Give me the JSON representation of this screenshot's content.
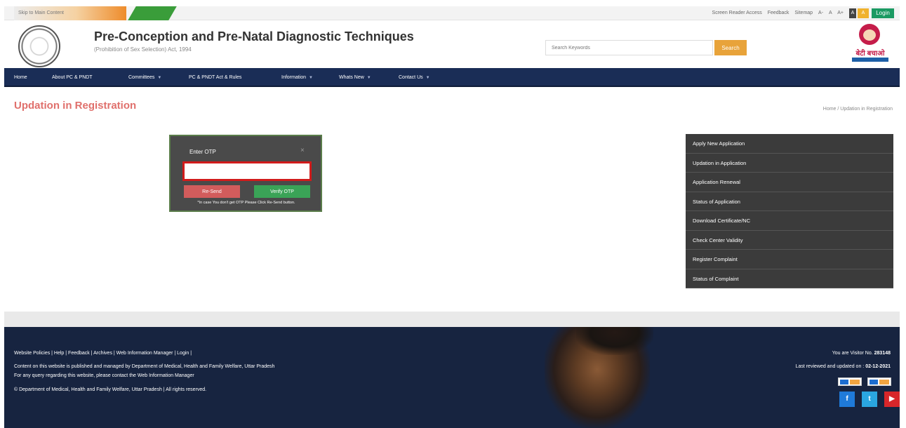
{
  "topbar": {
    "skip_label": "Skip to Main Content",
    "links": [
      "Screen Reader Access",
      "Feedback",
      "Sitemap",
      "A-",
      "A",
      "A+"
    ],
    "contrast_a": "A",
    "contrast_c": "A",
    "login_label": "Login"
  },
  "header": {
    "title": "Pre-Conception and Pre-Natal Diagnostic Techniques",
    "subtitle": "(Prohibition of Sex Selection) Act, 1994",
    "search_placeholder": "Search Keywords",
    "search_button": "Search",
    "logo_text": "बेटी बचाओ"
  },
  "nav": {
    "items": [
      {
        "label": "Home",
        "dropdown": false
      },
      {
        "label": "About PC & PNDT",
        "dropdown": false
      },
      {
        "label": "Committees",
        "dropdown": true
      },
      {
        "label": "PC & PNDT Act & Rules",
        "dropdown": false
      },
      {
        "label": "Information",
        "dropdown": true
      },
      {
        "label": "Whats New",
        "dropdown": true
      },
      {
        "label": "Contact Us",
        "dropdown": true
      }
    ]
  },
  "page": {
    "title": "Updation in Registration",
    "breadcrumb": "Home / Updation in Registration"
  },
  "otp": {
    "label": "Enter OTP",
    "close": "×",
    "value": "",
    "resend_label": "Re-Send",
    "verify_label": "Verify OTP",
    "note": "*In case You don't get OTP Please Click Re-Send button."
  },
  "sidebar": {
    "items": [
      {
        "label": "Apply New Application"
      },
      {
        "label": "Updation in Application"
      },
      {
        "label": "Application Renewal"
      },
      {
        "label": "Status of Application"
      },
      {
        "label": "Download Certificate/NC"
      },
      {
        "label": "Check Center Validity"
      },
      {
        "label": "Register Complaint"
      },
      {
        "label": "Status of Complaint"
      }
    ]
  },
  "footer": {
    "links": "Website Policies | Help | Feedback | Archives | Web Information Manager | Login |",
    "line1": "Content on this website is published and managed by Department of Medical, Health and Family Welfare, Uttar Pradesh",
    "line2": "For any query regarding this website, please contact the Web Information Manager",
    "line3": "© Department of Medical, Health and Family Welfare, Uttar Pradesh | All rights reserved.",
    "visitor_label": "You are Visitor No.",
    "visitor_count": "283148",
    "updated_label": "Last reviewed and updated on :",
    "updated_date": "02-12-2021",
    "social": {
      "facebook": "f",
      "twitter": "t",
      "youtube": "▶"
    }
  }
}
